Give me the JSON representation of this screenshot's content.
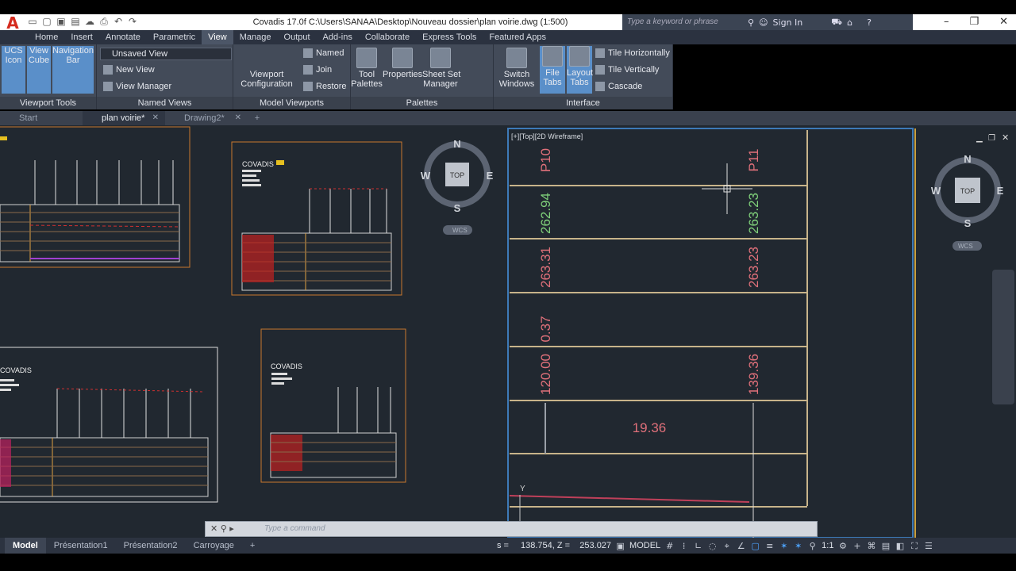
{
  "app": {
    "title": "Covadis 17.0f    C:\\Users\\SANAA\\Desktop\\Nouveau dossier\\plan voirie.dwg (1:500)",
    "search_placeholder": "Type a keyword or phrase",
    "sign_in": "Sign In",
    "logo": "A"
  },
  "menu_tabs": [
    "Home",
    "Insert",
    "Annotate",
    "Parametric",
    "View",
    "Manage",
    "Output",
    "Add-ins",
    "Collaborate",
    "Express Tools",
    "Featured Apps"
  ],
  "ribbon": {
    "viewport_tools": {
      "title": "Viewport Tools",
      "ucs": "UCS\nIcon",
      "cube": "View\nCube",
      "nav": "Navigation\nBar"
    },
    "named_views": {
      "title": "Named Views",
      "current": "Unsaved View",
      "new_view": "New View",
      "view_manager": "View Manager"
    },
    "model_viewports": {
      "title": "Model Viewports",
      "config": "Viewport\nConfiguration",
      "named": "Named",
      "join": "Join",
      "restore": "Restore"
    },
    "palettes": {
      "title": "Palettes",
      "tool": "Tool\nPalettes",
      "properties": "Properties",
      "sheet": "Sheet Set\nManager"
    },
    "interface": {
      "title": "Interface",
      "switch": "Switch\nWindows",
      "file_tabs": "File\nTabs",
      "layout_tabs": "Layout\nTabs",
      "tile_h": "Tile Horizontally",
      "tile_v": "Tile Vertically",
      "cascade": "Cascade"
    }
  },
  "doc_tabs": [
    "Start",
    "plan voirie*",
    "Drawing2*"
  ],
  "viewport_label": "[+][Top][2D Wireframe]",
  "viewcube": {
    "n": "N",
    "s": "S",
    "e": "E",
    "w": "W",
    "top": "TOP",
    "wcs": "WCS"
  },
  "drawing": {
    "covadis_label": "COVADIS",
    "profile_labels": [
      "P10",
      "P11"
    ],
    "left_values": [
      "262.94",
      "263.31",
      "0.37",
      "120.00"
    ],
    "right_values": [
      "263.23",
      "263.23",
      "139.36"
    ],
    "distance": "19.36",
    "ucs_y": "Y",
    "colors": {
      "green": "#7fd07a",
      "red": "#e0707a",
      "frame": "#c8b48a"
    }
  },
  "command": {
    "placeholder": "Type a command"
  },
  "layout_tabs": [
    "Model",
    "Présentation1",
    "Présentation2",
    "Carroyage"
  ],
  "status": {
    "coords": "138.754, Z =    253.027",
    "space": "MODEL",
    "scale": "1:1",
    "prefix": "s ="
  }
}
